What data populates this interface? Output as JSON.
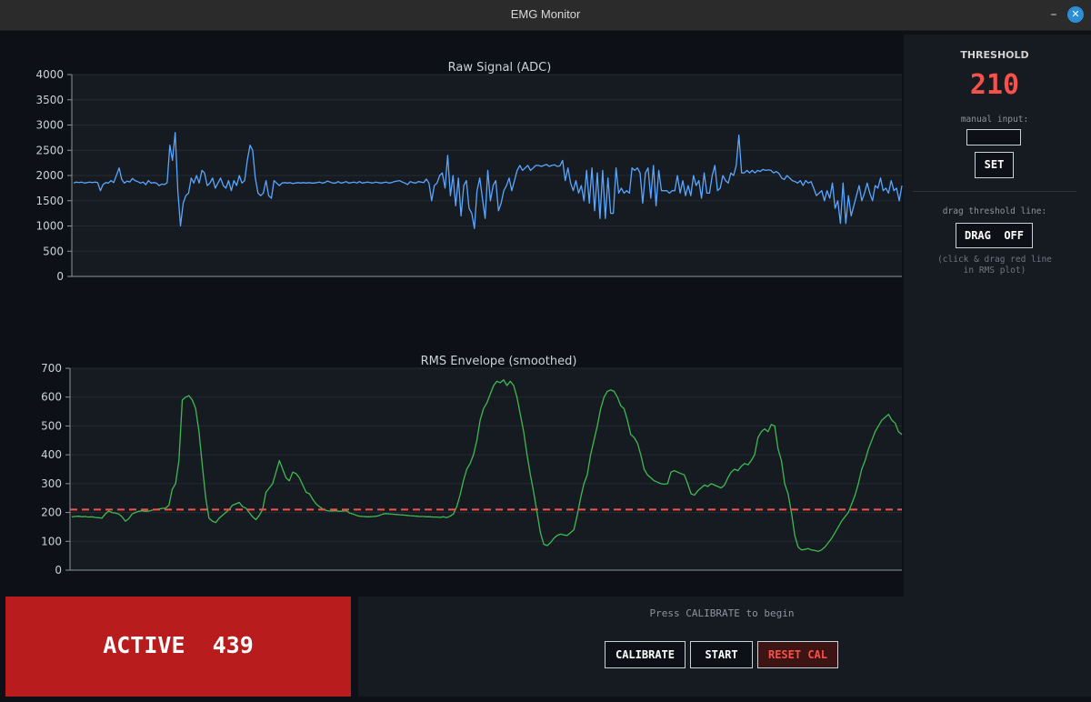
{
  "window": {
    "title": "EMG Monitor"
  },
  "sidebar": {
    "threshold_title": "THRESHOLD",
    "threshold_value": "210",
    "manual_input_label": "manual input:",
    "manual_input_value": "",
    "set_label": "SET",
    "drag_label": "drag threshold line:",
    "drag_button_label": "DRAG  OFF",
    "drag_hint_line1": "(click & drag red line",
    "drag_hint_line2": "in RMS plot)"
  },
  "state": {
    "text": "ACTIVE  439"
  },
  "controls": {
    "status": "Press CALIBRATE to begin",
    "calibrate_label": "CALIBRATE",
    "start_label": "START",
    "reset_label": "RESET CAL"
  },
  "colors": {
    "raw_line": "#58a6ff",
    "rms_line": "#3fb950",
    "threshold": "#f85149",
    "active": "#b91c1c"
  },
  "chart_data": [
    {
      "type": "line",
      "title": "Raw Signal  (ADC)",
      "ylim": [
        0,
        4000
      ],
      "yticks": [
        0,
        500,
        1000,
        1500,
        2000,
        2500,
        3000,
        3500,
        4000
      ],
      "grid": true,
      "series": [
        {
          "values": [
            1850,
            1870,
            1860,
            1870,
            1850,
            1860,
            1870,
            1860,
            1870,
            1860,
            1700,
            1820,
            1860,
            1850,
            1900,
            1860,
            2000,
            2150,
            1920,
            1850,
            1890,
            1870,
            1940,
            1900,
            1880,
            1850,
            1870,
            1820,
            1900,
            1850,
            1860,
            1850,
            1800,
            1830,
            1820,
            1860,
            2600,
            2300,
            2850,
            1700,
            1000,
            1450,
            1600,
            1650,
            1950,
            1850,
            2000,
            1850,
            2100,
            2050,
            1800,
            1850,
            1950,
            1750,
            1850,
            1950,
            1800,
            1750,
            1900,
            1700,
            1900,
            1800,
            2000,
            1850,
            1900,
            2300,
            2600,
            2500,
            1950,
            1650,
            1600,
            1650,
            1900,
            1600,
            1550,
            1900,
            1850,
            1800,
            1850,
            1860,
            1850,
            1860,
            1840,
            1850,
            1860,
            1850,
            1860,
            1850,
            1860,
            1850,
            1850,
            1860,
            1870,
            1850,
            1860,
            1890,
            1870,
            1850,
            1850,
            1880,
            1850,
            1860,
            1880,
            1850,
            1860,
            1870,
            1850,
            1880,
            1850,
            1860,
            1870,
            1860,
            1850,
            1870,
            1860,
            1850,
            1860,
            1870,
            1850,
            1860,
            1880,
            1890,
            1900,
            1870,
            1850,
            1820,
            1880,
            1860,
            1850,
            1880,
            1870,
            1860,
            1930,
            1850,
            1500,
            1800,
            1850,
            2000,
            2050,
            1750,
            2400,
            1600,
            2000,
            1400,
            1950,
            1200,
            1800,
            1900,
            1350,
            1250,
            950,
            1700,
            1950,
            1550,
            1150,
            2100,
            1500,
            1800,
            1900,
            1300,
            1450,
            1700,
            1800,
            1950,
            1700,
            1900,
            2100,
            2200,
            2100,
            2150,
            2200,
            2100,
            2150,
            2200,
            2200,
            2180,
            2200,
            2220,
            2180,
            2200,
            2210,
            2180,
            2190,
            2300,
            1900,
            2150,
            1850,
            1700,
            1900,
            1650,
            1800,
            1500,
            2100,
            1450,
            2150,
            1300,
            2050,
            1150,
            2100,
            1150,
            1950,
            1250,
            1250,
            2150,
            1650,
            1750,
            1650,
            1700,
            1650,
            2150,
            2100,
            2150,
            2050,
            1450,
            2050,
            2150,
            1550,
            2200,
            1400,
            2100,
            1700,
            1700,
            1700,
            1650,
            1700,
            1700,
            2000,
            1650,
            1900,
            1600,
            1800,
            1600,
            2000,
            1800,
            1900,
            1550,
            2050,
            1650,
            1650,
            2000,
            2200,
            1700,
            1750,
            2000,
            1900,
            1850,
            2050,
            2000,
            2200,
            2800,
            2050,
            2050,
            2100,
            2050,
            2100,
            2050,
            2100,
            2080,
            2120,
            2100,
            2110,
            2100,
            2050,
            2080,
            2040,
            1950,
            1920,
            2000,
            1950,
            1900,
            1880,
            1850,
            1900,
            1800,
            1900,
            1850,
            1880,
            1750,
            1600,
            1650,
            1700,
            1500,
            1700,
            1550,
            1850,
            1350,
            1500,
            1050,
            1850,
            1050,
            1600,
            1200,
            1400,
            1600,
            1800,
            1500,
            1650,
            1850,
            1650,
            1500,
            1800,
            1750,
            1950,
            1700,
            1750,
            1650,
            1900,
            1700,
            1750,
            1500,
            1800
          ]
        }
      ]
    },
    {
      "type": "line",
      "title": "RMS Envelope (smoothed)",
      "ylim": [
        0,
        700
      ],
      "yticks": [
        0,
        100,
        200,
        300,
        400,
        500,
        600,
        700
      ],
      "grid": true,
      "threshold": 210,
      "series": [
        {
          "values": [
            185,
            186,
            187,
            185,
            186,
            184,
            185,
            183,
            182,
            180,
            195,
            205,
            200,
            198,
            195,
            185,
            170,
            178,
            195,
            200,
            204,
            206,
            204,
            205,
            208,
            210,
            212,
            214,
            215,
            225,
            280,
            300,
            380,
            590,
            600,
            605,
            590,
            560,
            480,
            360,
            250,
            180,
            170,
            165,
            180,
            190,
            200,
            210,
            225,
            230,
            235,
            220,
            215,
            200,
            185,
            175,
            190,
            210,
            270,
            285,
            300,
            340,
            380,
            350,
            320,
            310,
            340,
            335,
            320,
            295,
            270,
            265,
            245,
            230,
            220,
            212,
            207,
            205,
            205,
            206,
            204,
            205,
            206,
            198,
            195,
            190,
            187,
            186,
            185,
            185,
            186,
            187,
            190,
            195,
            196,
            195,
            194,
            193,
            192,
            191,
            190,
            189,
            188,
            187,
            186,
            186,
            185,
            185,
            184,
            184,
            183,
            185,
            182,
            187,
            195,
            220,
            260,
            310,
            350,
            370,
            400,
            450,
            520,
            560,
            580,
            610,
            640,
            655,
            650,
            660,
            640,
            655,
            640,
            600,
            540,
            480,
            400,
            330,
            270,
            200,
            130,
            90,
            85,
            95,
            110,
            120,
            125,
            122,
            120,
            130,
            140,
            190,
            250,
            300,
            330,
            400,
            450,
            500,
            560,
            600,
            620,
            625,
            620,
            600,
            570,
            560,
            520,
            470,
            460,
            440,
            400,
            350,
            330,
            320,
            310,
            305,
            300,
            298,
            300,
            340,
            345,
            340,
            335,
            330,
            300,
            265,
            260,
            275,
            285,
            295,
            290,
            300,
            295,
            290,
            285,
            295,
            320,
            340,
            350,
            345,
            360,
            370,
            365,
            380,
            400,
            460,
            480,
            490,
            480,
            505,
            500,
            420,
            380,
            300,
            265,
            200,
            120,
            80,
            70,
            72,
            75,
            70,
            68,
            65,
            70,
            80,
            95,
            110,
            130,
            150,
            170,
            185,
            200,
            230,
            260,
            300,
            350,
            380,
            420,
            450,
            480,
            500,
            520,
            530,
            540,
            520,
            510,
            480,
            470
          ]
        }
      ]
    }
  ]
}
